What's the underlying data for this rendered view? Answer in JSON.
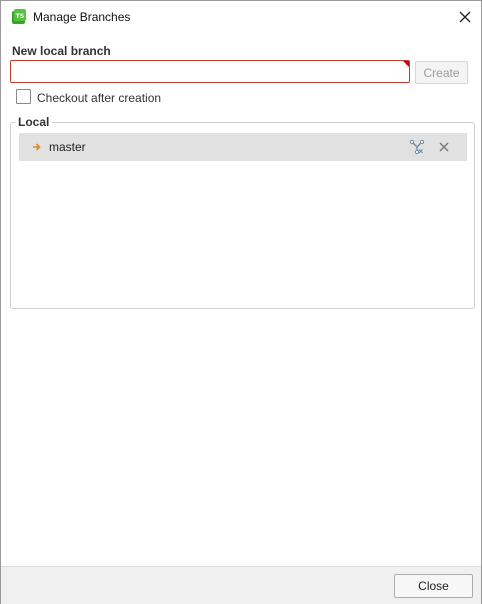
{
  "window": {
    "title": "Manage Branches",
    "app_icon_text": "TS",
    "app_icon_color": "#3aa329"
  },
  "new_branch": {
    "label": "New local branch",
    "value": "",
    "placeholder": "",
    "create_label": "Create",
    "create_enabled": false,
    "error_color": "#c0392b"
  },
  "checkout": {
    "label": "Checkout after creation",
    "checked": false
  },
  "local": {
    "label": "Local",
    "branches": [
      {
        "name": "master",
        "is_current": true
      }
    ]
  },
  "footer": {
    "close_label": "Close"
  },
  "icons": {
    "app": "tortoise-app-icon",
    "close": "close-icon",
    "current_branch": "arrow-right-icon",
    "merge": "merge-icon",
    "delete": "delete-icon"
  }
}
